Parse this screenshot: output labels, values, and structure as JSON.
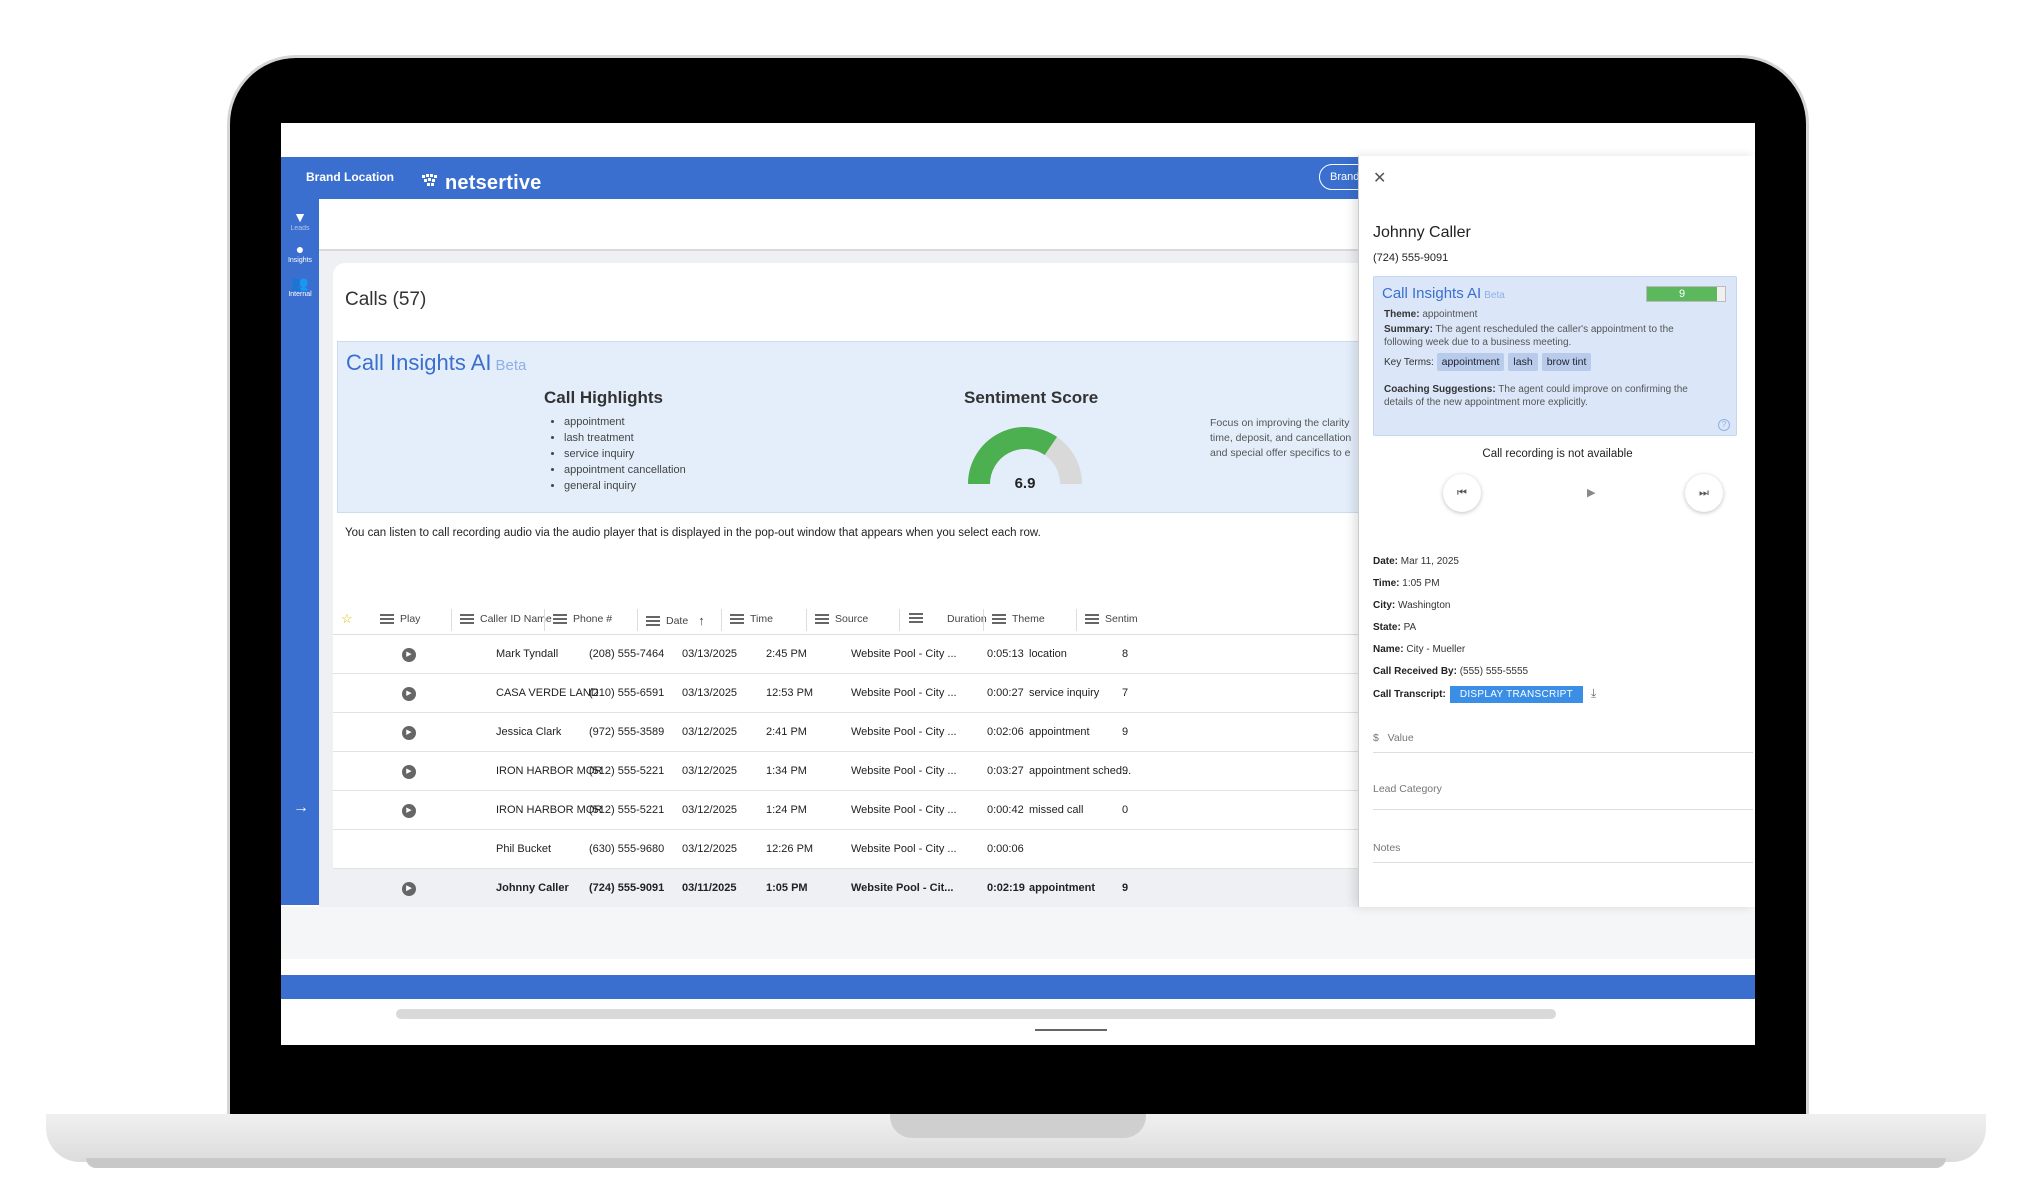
{
  "header": {
    "brand_location": "Brand Location",
    "logo_text": "netsertive",
    "brand_button": "Brand"
  },
  "nav": [
    {
      "icon": "filter-icon",
      "label": "Leads"
    },
    {
      "icon": "lightbulb-icon",
      "label": "Insights"
    },
    {
      "icon": "people-icon",
      "label": "Internal"
    }
  ],
  "calls": {
    "title": "Calls (57)",
    "insights": {
      "title": "Call Insights AI",
      "beta": "Beta",
      "highlights_title": "Call Highlights",
      "highlights": [
        "appointment",
        "lash treatment",
        "service inquiry",
        "appointment cancellation",
        "general inquiry"
      ],
      "sentiment_title": "Sentiment Score",
      "sentiment_value": "6.9",
      "sentiment_fraction": 0.69,
      "focus_lines": [
        "Focus on improving the clarity",
        "time, deposit, and cancellation",
        "and special offer specifics to e"
      ]
    },
    "info_text": "You can listen to call recording audio via the audio player that is displayed in the pop-out window that appears when you select each row."
  },
  "table": {
    "columns": {
      "play": "Play",
      "caller": "Caller ID Name",
      "phone": "Phone #",
      "date": "Date",
      "time": "Time",
      "source": "Source",
      "duration": "Duration",
      "theme": "Theme",
      "sentiment": "Sentim"
    },
    "rows": [
      {
        "caller": "Mark Tyndall",
        "phone": "(208) 555-7464",
        "date": "03/13/2025",
        "time": "2:45 PM",
        "source": "Website Pool - City ...",
        "duration": "0:05:13",
        "theme": "location",
        "sentiment": "8"
      },
      {
        "caller": "CASA VERDE LAND",
        "phone": "(210) 555-6591",
        "date": "03/13/2025",
        "time": "12:53 PM",
        "source": "Website Pool - City ...",
        "duration": "0:00:27",
        "theme": "service inquiry",
        "sentiment": "7"
      },
      {
        "caller": "Jessica Clark",
        "phone": "(972) 555-3589",
        "date": "03/12/2025",
        "time": "2:41 PM",
        "source": "Website Pool - City ...",
        "duration": "0:02:06",
        "theme": "appointment",
        "sentiment": "9"
      },
      {
        "caller": "IRON HARBOR MOR",
        "phone": "(512) 555-5221",
        "date": "03/12/2025",
        "time": "1:34 PM",
        "source": "Website Pool - City ...",
        "duration": "0:03:27",
        "theme": "appointment sched...",
        "sentiment": "9"
      },
      {
        "caller": "IRON HARBOR MOR",
        "phone": "(512) 555-5221",
        "date": "03/12/2025",
        "time": "1:24 PM",
        "source": "Website Pool - City ...",
        "duration": "0:00:42",
        "theme": "missed call",
        "sentiment": "0"
      },
      {
        "caller": "Phil Bucket",
        "phone": "(630) 555-9680",
        "date": "03/12/2025",
        "time": "12:26 PM",
        "source": "Website Pool - City ...",
        "duration": "0:00:06",
        "theme": "",
        "sentiment": ""
      },
      {
        "caller": "Johnny Caller",
        "phone": "(724) 555-9091",
        "date": "03/11/2025",
        "time": "1:05 PM",
        "source": "Website Pool - Cit...",
        "duration": "0:02:19",
        "theme": "appointment",
        "sentiment": "9"
      }
    ]
  },
  "panel": {
    "name": "Johnny Caller",
    "phone": "(724) 555-9091",
    "ai": {
      "title": "Call Insights AI",
      "beta": "Beta",
      "score": "9",
      "score_fraction": 0.9,
      "theme_label": "Theme:",
      "theme": "appointment",
      "summary_label": "Summary:",
      "summary_1": "The agent rescheduled the caller's appointment to the",
      "summary_2": "following week due to a business meeting.",
      "key_terms_label": "Key Terms:",
      "key_terms": [
        "appointment",
        "lash",
        "brow tint"
      ],
      "coaching_label": "Coaching Suggestions:",
      "coaching_1": "The agent could improve on confirming the",
      "coaching_2": "details of the new appointment more explicitly."
    },
    "recording_status": "Call recording is not available",
    "details": [
      {
        "label": "Date:",
        "value": "Mar 11, 2025"
      },
      {
        "label": "Time:",
        "value": "1:05 PM"
      },
      {
        "label": "City:",
        "value": "Washington"
      },
      {
        "label": "State:",
        "value": "PA"
      },
      {
        "label": "Name:",
        "value": "City - Mueller"
      },
      {
        "label": "Call Received By:",
        "value": "(555) 555-5555"
      }
    ],
    "transcript_label": "Call Transcript:",
    "transcript_button": "DISPLAY TRANSCRIPT",
    "value_prefix": "$",
    "value_placeholder": "Value",
    "lead_category": "Lead Category",
    "notes": "Notes"
  },
  "colors": {
    "brand_blue": "#3a6fcf",
    "score_green": "#5cb85c",
    "gauge_green": "#4caf50"
  }
}
